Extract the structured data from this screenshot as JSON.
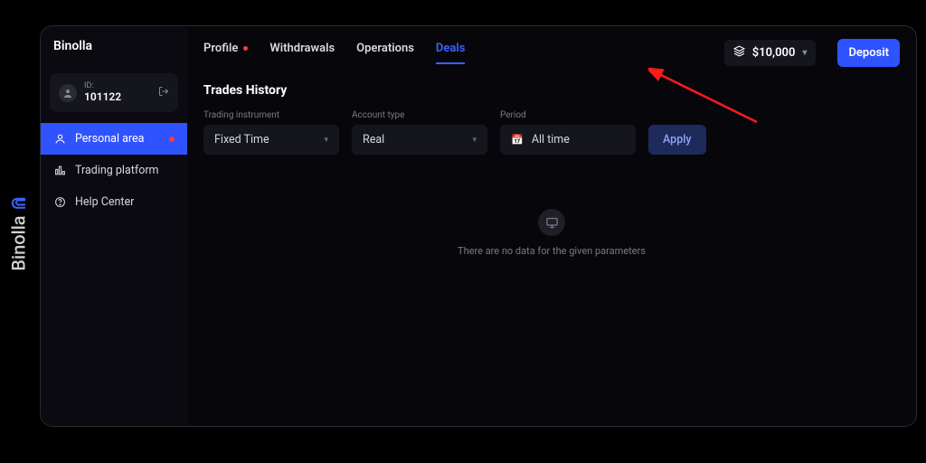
{
  "brand": "Binolla",
  "user": {
    "id_label": "ID:",
    "id_value": "101122"
  },
  "sidebar": {
    "items": [
      {
        "label": "Personal area",
        "active": true,
        "has_dot": true
      },
      {
        "label": "Trading platform"
      },
      {
        "label": "Help Center"
      }
    ]
  },
  "tabs": [
    {
      "label": "Profile",
      "has_dot": true
    },
    {
      "label": "Withdrawals"
    },
    {
      "label": "Operations"
    },
    {
      "label": "Deals",
      "active": true
    }
  ],
  "balance": {
    "amount": "$10,000"
  },
  "actions": {
    "deposit": "Deposit"
  },
  "section": {
    "title": "Trades History"
  },
  "filters": {
    "instrument_label": "Trading instrument",
    "instrument_value": "Fixed Time",
    "account_label": "Account type",
    "account_value": "Real",
    "period_label": "Period",
    "period_value": "All time",
    "apply": "Apply"
  },
  "empty": {
    "message": "There are no data for the given parameters"
  }
}
